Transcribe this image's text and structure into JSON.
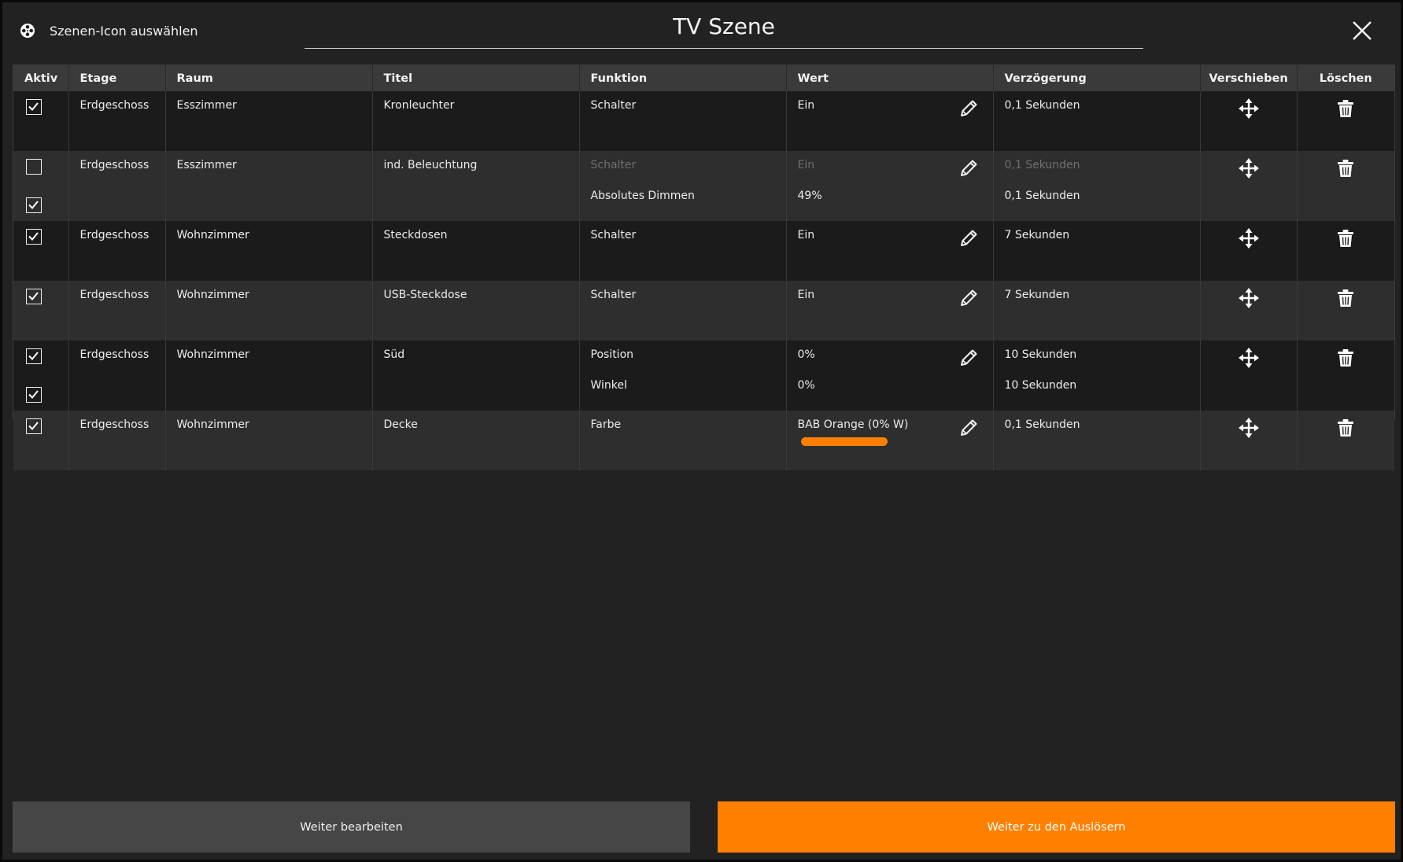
{
  "header": {
    "icon_select_label": "Szenen-Icon auswählen",
    "title": "TV Szene"
  },
  "table": {
    "columns": {
      "active": "Aktiv",
      "floor": "Etage",
      "room": "Raum",
      "title": "Titel",
      "function": "Funktion",
      "value": "Wert",
      "delay": "Verzögerung",
      "move": "Verschieben",
      "delete": "Löschen"
    },
    "rows": [
      {
        "floor": "Erdgeschoss",
        "room": "Esszimmer",
        "title": "Kronleuchter",
        "entries": [
          {
            "active": true,
            "function": "Schalter",
            "value": "Ein",
            "delay": "0,1 Sekunden"
          }
        ]
      },
      {
        "floor": "Erdgeschoss",
        "room": "Esszimmer",
        "title": "ind. Beleuchtung",
        "entries": [
          {
            "active": false,
            "function": "Schalter",
            "value": "Ein",
            "delay": "0,1 Sekunden"
          },
          {
            "active": true,
            "function": "Absolutes Dimmen",
            "value": "49%",
            "delay": "0,1 Sekunden"
          }
        ]
      },
      {
        "floor": "Erdgeschoss",
        "room": "Wohnzimmer",
        "title": "Steckdosen",
        "entries": [
          {
            "active": true,
            "function": "Schalter",
            "value": "Ein",
            "delay": "7 Sekunden"
          }
        ]
      },
      {
        "floor": "Erdgeschoss",
        "room": "Wohnzimmer",
        "title": "USB-Steckdose",
        "entries": [
          {
            "active": true,
            "function": "Schalter",
            "value": "Ein",
            "delay": "7 Sekunden"
          }
        ]
      },
      {
        "floor": "Erdgeschoss",
        "room": "Wohnzimmer",
        "title": "Süd",
        "entries": [
          {
            "active": true,
            "function": "Position",
            "value": "0%",
            "delay": "10 Sekunden"
          },
          {
            "active": true,
            "function": "Winkel",
            "value": "0%",
            "delay": "10 Sekunden"
          }
        ]
      },
      {
        "floor": "Erdgeschoss",
        "room": "Wohnzimmer",
        "title": "Decke",
        "entries": [
          {
            "active": true,
            "function": "Farbe",
            "value": "BAB Orange (0% W)",
            "delay": "0,1 Sekunden",
            "color": "#ff8000"
          }
        ]
      }
    ]
  },
  "footer": {
    "continue_edit": "Weiter bearbeiten",
    "continue_triggers": "Weiter zu den Auslösern"
  },
  "colors": {
    "accent": "#ff8000",
    "background": "#222222",
    "header_row": "#3a3a3a",
    "disabled_text": "#6f6f6f"
  },
  "icons": {
    "scene_icon": "film-reel-icon",
    "close": "close-icon",
    "edit": "pencil-icon",
    "move": "move-arrows-icon",
    "delete": "trash-icon",
    "check": "checkmark-icon"
  }
}
